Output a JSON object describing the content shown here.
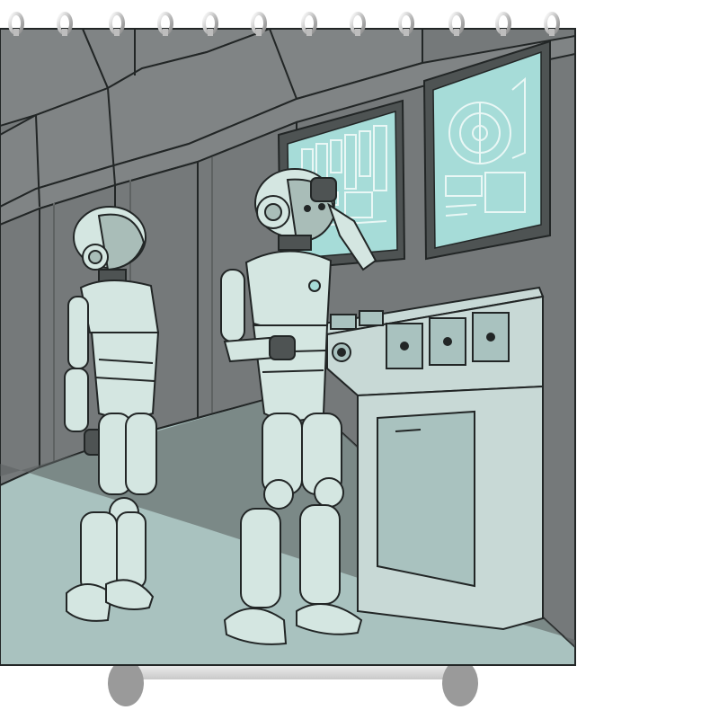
{
  "scene": {
    "subject": "shower-curtain-product-photo",
    "artwork": "two-robots-at-spaceship-control-panel",
    "colors": {
      "background": "#ffffff",
      "wall": "#75797a",
      "wall_light": "#808485",
      "floor": "#a9c2bf",
      "outline": "#222626",
      "robot_body": "#d4e6e1",
      "robot_shade": "#a9bdb8",
      "robot_joint": "#4e5353",
      "screen": "#a6dcd8",
      "screen_line": "#e9f7f5",
      "console": "#c8d9d6",
      "ring_metal": "#d9d9d9",
      "tub": "#e6e6e6"
    }
  }
}
